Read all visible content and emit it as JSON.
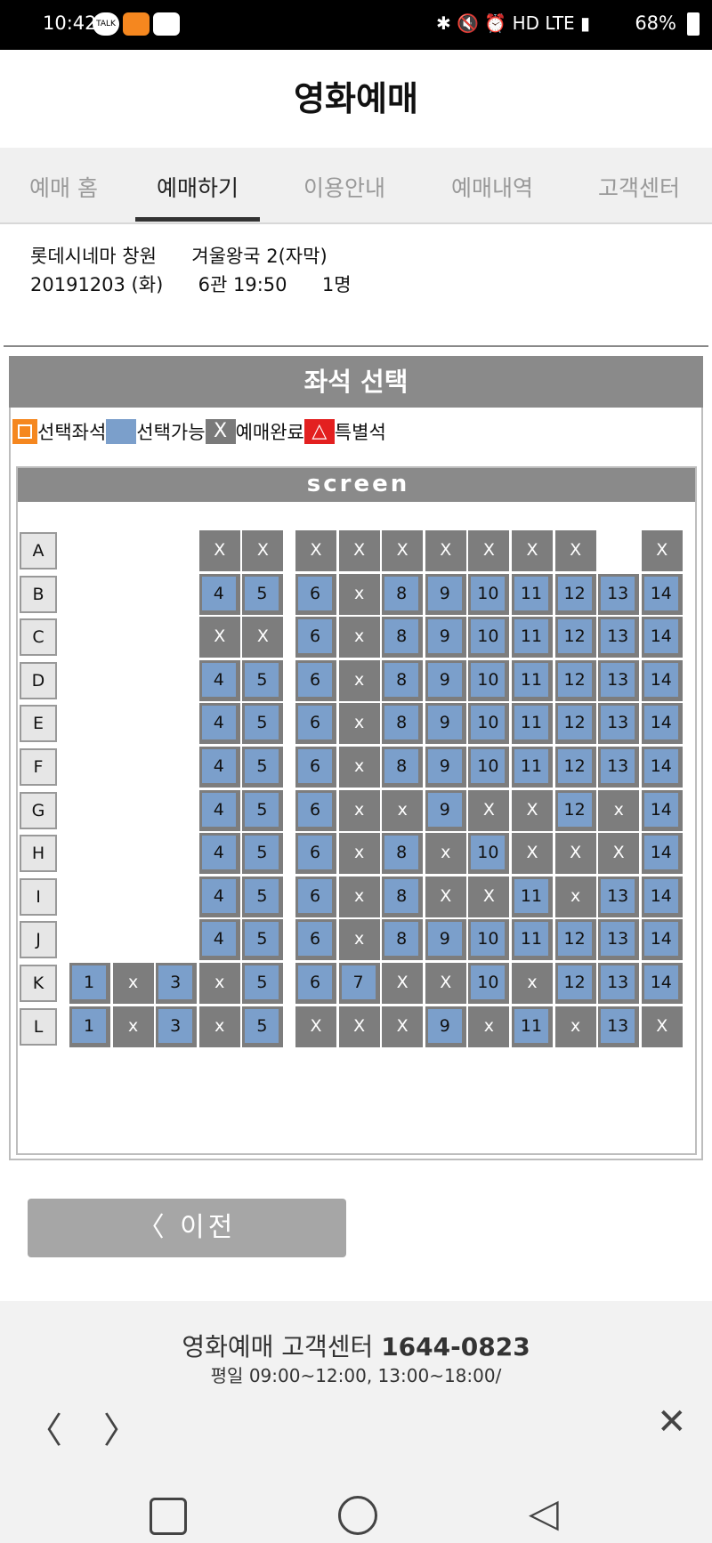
{
  "status": {
    "time": "10:42",
    "talk": "TALK",
    "battery": "68%"
  },
  "header": {
    "title": "영화예매"
  },
  "tabs": [
    "예매 홈",
    "예매하기",
    "이용안내",
    "예매내역",
    "고객센터"
  ],
  "booking": {
    "theater": "롯데시네마 창원",
    "movie": "겨울왕국 2(자막)",
    "date": "20191203 (화)",
    "hall_time": "6관 19:50",
    "count": "1명"
  },
  "panel": {
    "title": "좌석 선택",
    "screen": "screen"
  },
  "legend": {
    "selected": "선택좌석",
    "available": "선택가능",
    "booked_mark": "X",
    "booked": "예매완료",
    "special_mark": "△",
    "special": "특별석"
  },
  "seat_rows": [
    {
      "label": "A",
      "seats": [
        null,
        null,
        null,
        "X",
        "X",
        null,
        "X",
        "X",
        "X",
        "X",
        "X",
        "X",
        "X",
        null,
        "X"
      ]
    },
    {
      "label": "B",
      "seats": [
        null,
        null,
        null,
        "4",
        "5",
        null,
        "6",
        "x",
        "8",
        "9",
        "10",
        "11",
        "12",
        "13",
        "14"
      ]
    },
    {
      "label": "C",
      "seats": [
        null,
        null,
        null,
        "X",
        "X",
        null,
        "6",
        "x",
        "8",
        "9",
        "10",
        "11",
        "12",
        "13",
        "14"
      ]
    },
    {
      "label": "D",
      "seats": [
        null,
        null,
        null,
        "4",
        "5",
        null,
        "6",
        "x",
        "8",
        "9",
        "10",
        "11",
        "12",
        "13",
        "14"
      ]
    },
    {
      "label": "E",
      "seats": [
        null,
        null,
        null,
        "4",
        "5",
        null,
        "6",
        "x",
        "8",
        "9",
        "10",
        "11",
        "12",
        "13",
        "14"
      ]
    },
    {
      "label": "F",
      "seats": [
        null,
        null,
        null,
        "4",
        "5",
        null,
        "6",
        "x",
        "8",
        "9",
        "10",
        "11",
        "12",
        "13",
        "14"
      ]
    },
    {
      "label": "G",
      "seats": [
        null,
        null,
        null,
        "4",
        "5",
        null,
        "6",
        "x",
        "x",
        "9",
        "X",
        "X",
        "12",
        "x",
        "14"
      ]
    },
    {
      "label": "H",
      "seats": [
        null,
        null,
        null,
        "4",
        "5",
        null,
        "6",
        "x",
        "8",
        "x",
        "10",
        "X",
        "X",
        "X",
        "14"
      ]
    },
    {
      "label": "I",
      "seats": [
        null,
        null,
        null,
        "4",
        "5",
        null,
        "6",
        "x",
        "8",
        "X",
        "X",
        "11",
        "x",
        "13",
        "14"
      ]
    },
    {
      "label": "J",
      "seats": [
        null,
        null,
        null,
        "4",
        "5",
        null,
        "6",
        "x",
        "8",
        "9",
        "10",
        "11",
        "12",
        "13",
        "14"
      ]
    },
    {
      "label": "K",
      "seats": [
        "1",
        "x",
        "3",
        "x",
        "5",
        null,
        "6",
        "7",
        "X",
        "X",
        "10",
        "x",
        "12",
        "13",
        "14"
      ]
    },
    {
      "label": "L",
      "seats": [
        "1",
        "x",
        "3",
        "x",
        "5",
        null,
        "X",
        "X",
        "X",
        "9",
        "x",
        "11",
        "x",
        "13",
        "X"
      ]
    }
  ],
  "prev_button": "〈 이전",
  "footer": {
    "line1_prefix": "영화예매 고객센터 ",
    "phone": "1644-0823",
    "hours": "평일 09:00~12:00, 13:00~18:00/"
  },
  "nav": {
    "back": "〈",
    "forward": "〉",
    "close": "✕"
  },
  "colors": {
    "available": "#7b9fcb",
    "booked": "#7d7d7d",
    "selected": "#f5871f",
    "special": "#e32020"
  }
}
